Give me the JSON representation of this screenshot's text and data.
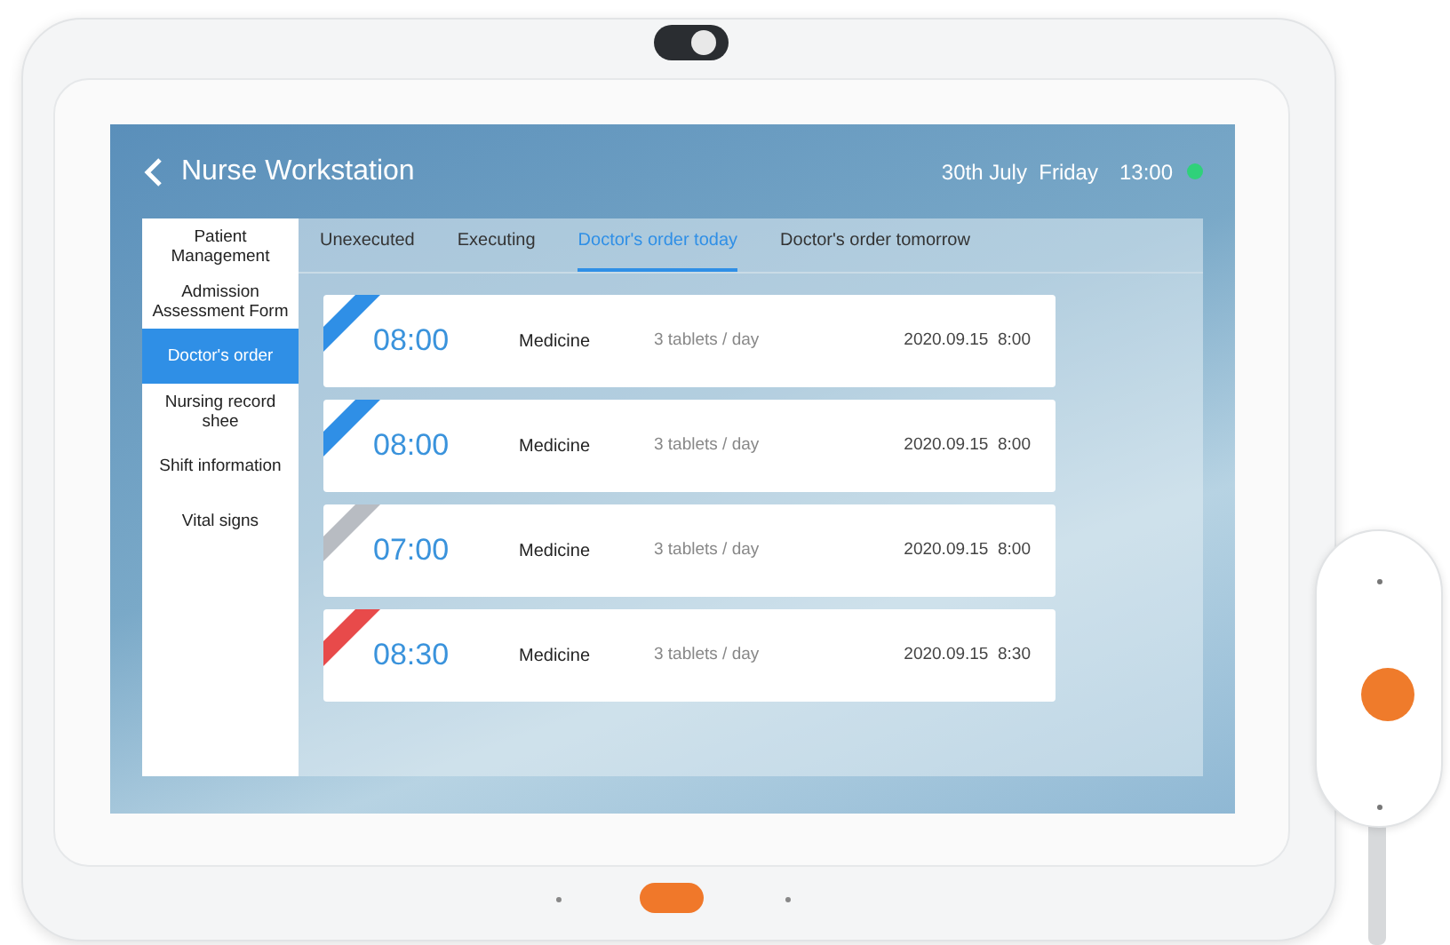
{
  "header": {
    "title": "Nurse Workstation",
    "date": "30th July  Friday",
    "time": "13:00",
    "online": true
  },
  "sidebar": {
    "items": [
      {
        "label": "Patient Management",
        "selected": false
      },
      {
        "label": "Admission Assessment Form",
        "selected": false
      },
      {
        "label": "Doctor's order",
        "selected": true
      },
      {
        "label": "Nursing record shee",
        "selected": false
      },
      {
        "label": "Shift information",
        "selected": false
      },
      {
        "label": "Vital signs",
        "selected": false
      }
    ]
  },
  "tabs": [
    {
      "label": "Unexecuted",
      "selected": false
    },
    {
      "label": "Executing",
      "selected": false
    },
    {
      "label": "Doctor's order today",
      "selected": true
    },
    {
      "label": "Doctor's order tomorrow",
      "selected": false
    }
  ],
  "orders": [
    {
      "time": "08:00",
      "name": "Medicine",
      "dosage": "3 tablets / day",
      "date": "2020.09.15  8:00",
      "color": "#2f8fe6"
    },
    {
      "time": "08:00",
      "name": "Medicine",
      "dosage": "3 tablets / day",
      "date": "2020.09.15  8:00",
      "color": "#2f8fe6"
    },
    {
      "time": "07:00",
      "name": "Medicine",
      "dosage": "3 tablets / day",
      "date": "2020.09.15  8:00",
      "color": "#b8bcc2"
    },
    {
      "time": "08:30",
      "name": "Medicine",
      "dosage": "3 tablets / day",
      "date": "2020.09.15  8:30",
      "color": "#e84a4a"
    }
  ]
}
